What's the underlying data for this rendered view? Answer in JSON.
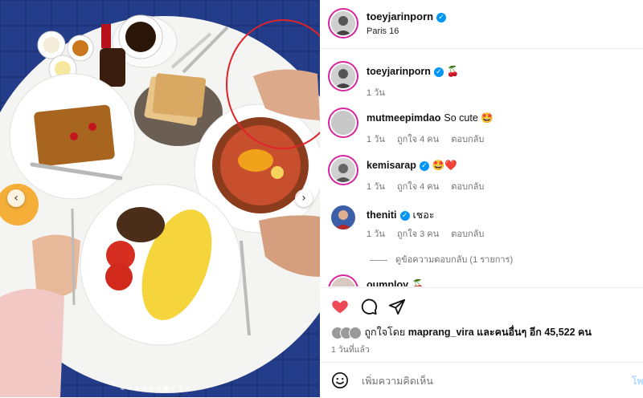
{
  "post": {
    "author": "toeyjarinporn",
    "location": "Paris 16"
  },
  "comments": [
    {
      "user": "toeyjarinporn",
      "text": "🍒",
      "time": "1 วัน",
      "likes": "",
      "reply": ""
    },
    {
      "user": "mutmeepimdao",
      "text": "So cute 🤩",
      "time": "1 วัน",
      "likes": "ถูกใจ 4 คน",
      "reply": "ตอบกลับ"
    },
    {
      "user": "kemisarap",
      "text": "🤩❤️",
      "time": "1 วัน",
      "likes": "ถูกใจ 4 คน",
      "reply": "ตอบกลับ"
    },
    {
      "user": "theniti",
      "text": "เชอะ",
      "time": "1 วัน",
      "likes": "ถูกใจ 3 คน",
      "reply": "ตอบกลับ"
    },
    {
      "user": "oumploy",
      "text": "🍒",
      "time": "",
      "likes": "",
      "reply": ""
    }
  ],
  "view_replies": "ดูข้อความตอบกลับ (1 รายการ)",
  "likes": {
    "prefix": "ถูกใจโดย",
    "user": "maprang_vira",
    "mid": "และคนอื่นๆ อีก",
    "count": "45,522",
    "suffix": "คน"
  },
  "posted_ago": "1 วันที่แล้ว",
  "comment_box": {
    "placeholder": "เพิ่มความคิดเห็น",
    "post_label": "โพสต์"
  },
  "colors": {
    "heart": "#ed4956",
    "verified": "#0095f6",
    "circle_annotation": "#e0232a"
  },
  "icons": [
    "heart-icon",
    "comment-icon",
    "share-icon",
    "emoji-icon",
    "verified-icon",
    "chevron-left-icon",
    "chevron-right-icon"
  ],
  "carousel": {
    "slides": 10,
    "active_slide": 7
  }
}
